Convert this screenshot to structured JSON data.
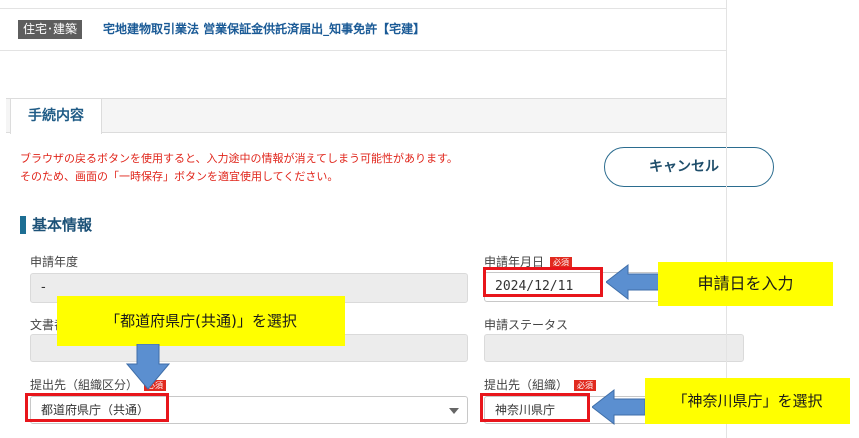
{
  "header": {
    "category": "住宅･建築",
    "procedure_title": "宅地建物取引業法 営業保証金供託済届出_知事免許【宅建】"
  },
  "tabs": [
    {
      "label": "手続内容",
      "active": true
    }
  ],
  "warning": {
    "line1": "ブラウザの戻るボタンを使用すると、入力途中の情報が消えてしまう可能性があります。",
    "line2": "そのため、画面の「一時保存」ボタンを適宜使用してください。"
  },
  "buttons": {
    "cancel": "キャンセル"
  },
  "section": {
    "title": "基本情報"
  },
  "form": {
    "required_badge": "必須",
    "fiscal_year": {
      "label": "申請年度",
      "value": "-"
    },
    "application_date": {
      "label": "申請年月日",
      "value": "2024/12/11",
      "required": true
    },
    "document_label_partial": "文書番",
    "application_status": {
      "label": "申請ステータス",
      "value": ""
    },
    "submit_org_type": {
      "label": "提出先（組織区分）",
      "value": "都道府県庁（共通）",
      "required": true
    },
    "submit_org": {
      "label": "提出先（組織）",
      "value": "神奈川県庁",
      "required": true
    }
  },
  "annotations": {
    "date_callout": "申請日を入力",
    "org_type_callout": "「都道府県庁(共通)」を選択",
    "org_callout": "「神奈川県庁」を選択"
  },
  "colors": {
    "accent": "#1d6e93",
    "warning_text": "#e0251b",
    "required_badge": "#e12a1f",
    "annotation_frame": "#e8151b",
    "callout_fill": "#ffff00",
    "arrow_fill": "#5b8fd0"
  }
}
